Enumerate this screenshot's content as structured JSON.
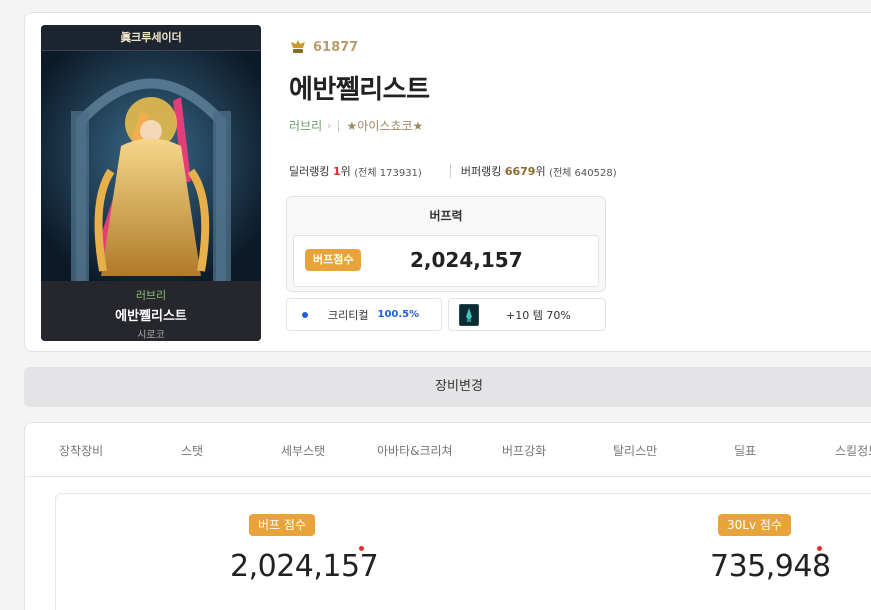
{
  "character": {
    "frame_title": "眞크루세이더",
    "adventure_name": "러브리",
    "name": "에반쩰리스트",
    "server": "시로코",
    "fame": "61877",
    "guild_link": "러브리",
    "guild_name": "★아이스쵸코★"
  },
  "ranking": {
    "dealer_label": "딜러랭킹",
    "dealer_rank": "1",
    "rank_suffix": "위",
    "dealer_total": "(전체 173931)",
    "buffer_label": "버퍼랭킹",
    "buffer_rank": "6679",
    "buffer_total": "(전체 640528)"
  },
  "buff": {
    "title": "버프력",
    "badge": "버프점수",
    "value": "2,024,157"
  },
  "stats": {
    "crit_label": "크리티컬",
    "crit_value": "100.5%",
    "enhance_text": "+10 템 70%"
  },
  "equip_change_label": "장비변경",
  "tabs": [
    "장착장비",
    "스탯",
    "세부스탯",
    "아바타&크리쳐",
    "버프강화",
    "탈리스만",
    "딜표",
    "스킬정보"
  ],
  "scores": {
    "buff_badge": "버프 점수",
    "buff_value": "2,024,157",
    "lv30_badge": "30Lv 점수",
    "lv30_value": "735,948"
  },
  "colors": {
    "accent_orange": "#e8a43a",
    "rank_red": "#d62b2b",
    "crit_blue": "#1f5fe0",
    "guild_green": "#6aa06a"
  }
}
